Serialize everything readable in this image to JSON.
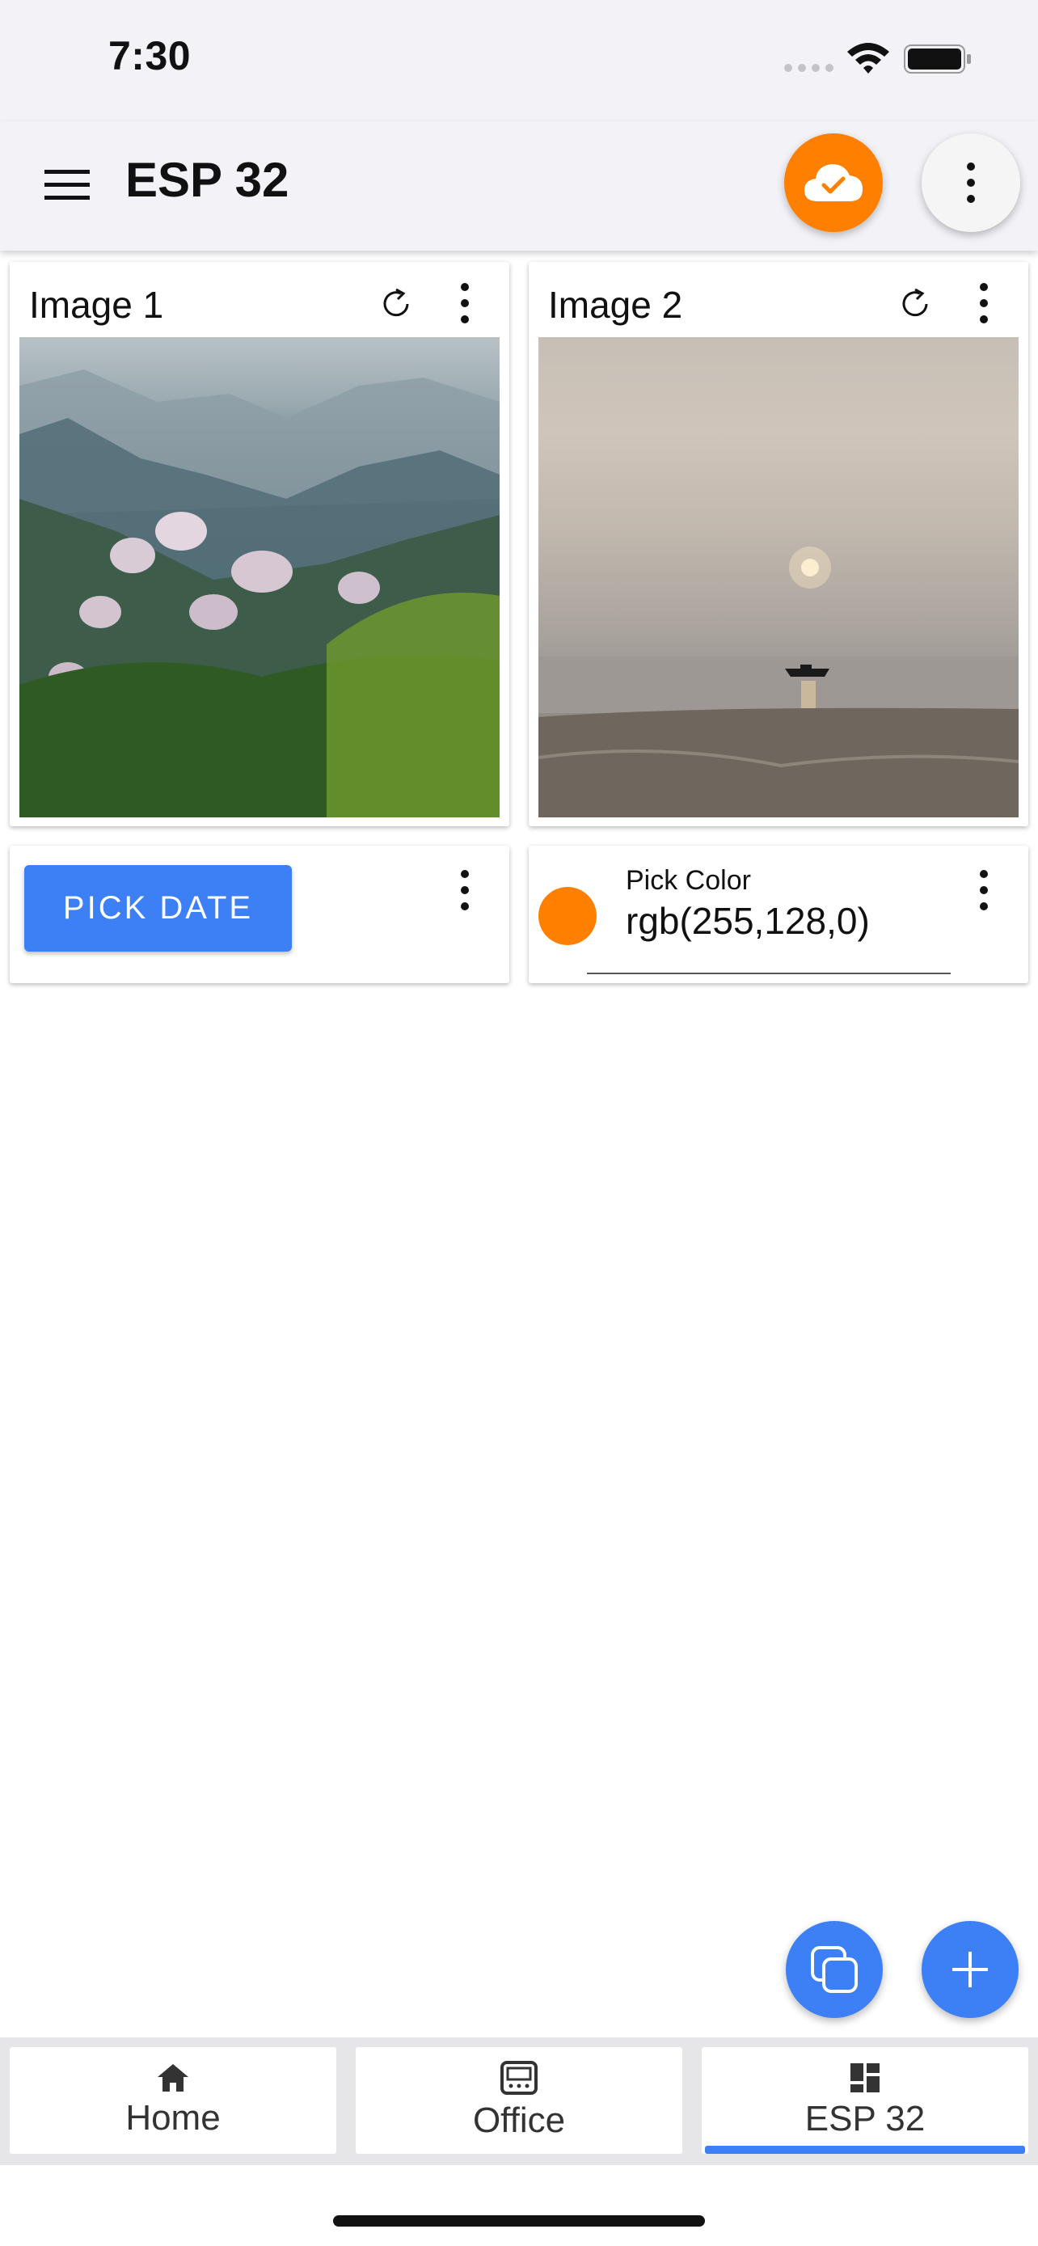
{
  "status_bar": {
    "time": "7:30"
  },
  "app_bar": {
    "title": "ESP 32",
    "menu_icon": "hamburger-menu-icon",
    "cloud_icon": "cloud-check-icon",
    "more_icon": "more-vertical-icon",
    "cloud_color": "#ff8000"
  },
  "widgets": {
    "image1": {
      "title": "Image 1",
      "image": "mountain-flowers-photo"
    },
    "image2": {
      "title": "Image 2",
      "image": "sunset-boat-photo"
    },
    "date_picker": {
      "button_label": "PICK DATE"
    },
    "color_picker": {
      "label": "Pick Color",
      "value": "rgb(255,128,0)",
      "swatch_color": "#ff8000"
    }
  },
  "fabs": {
    "duplicate_icon": "copy-icon",
    "add_icon": "plus-icon"
  },
  "tabs": [
    {
      "label": "Home",
      "icon": "home-icon"
    },
    {
      "label": "Office",
      "icon": "display-icon"
    },
    {
      "label": "ESP 32",
      "icon": "dashboard-icon",
      "selected": true
    }
  ],
  "colors": {
    "accent": "#3d7ff5",
    "orange": "#ff8000"
  }
}
